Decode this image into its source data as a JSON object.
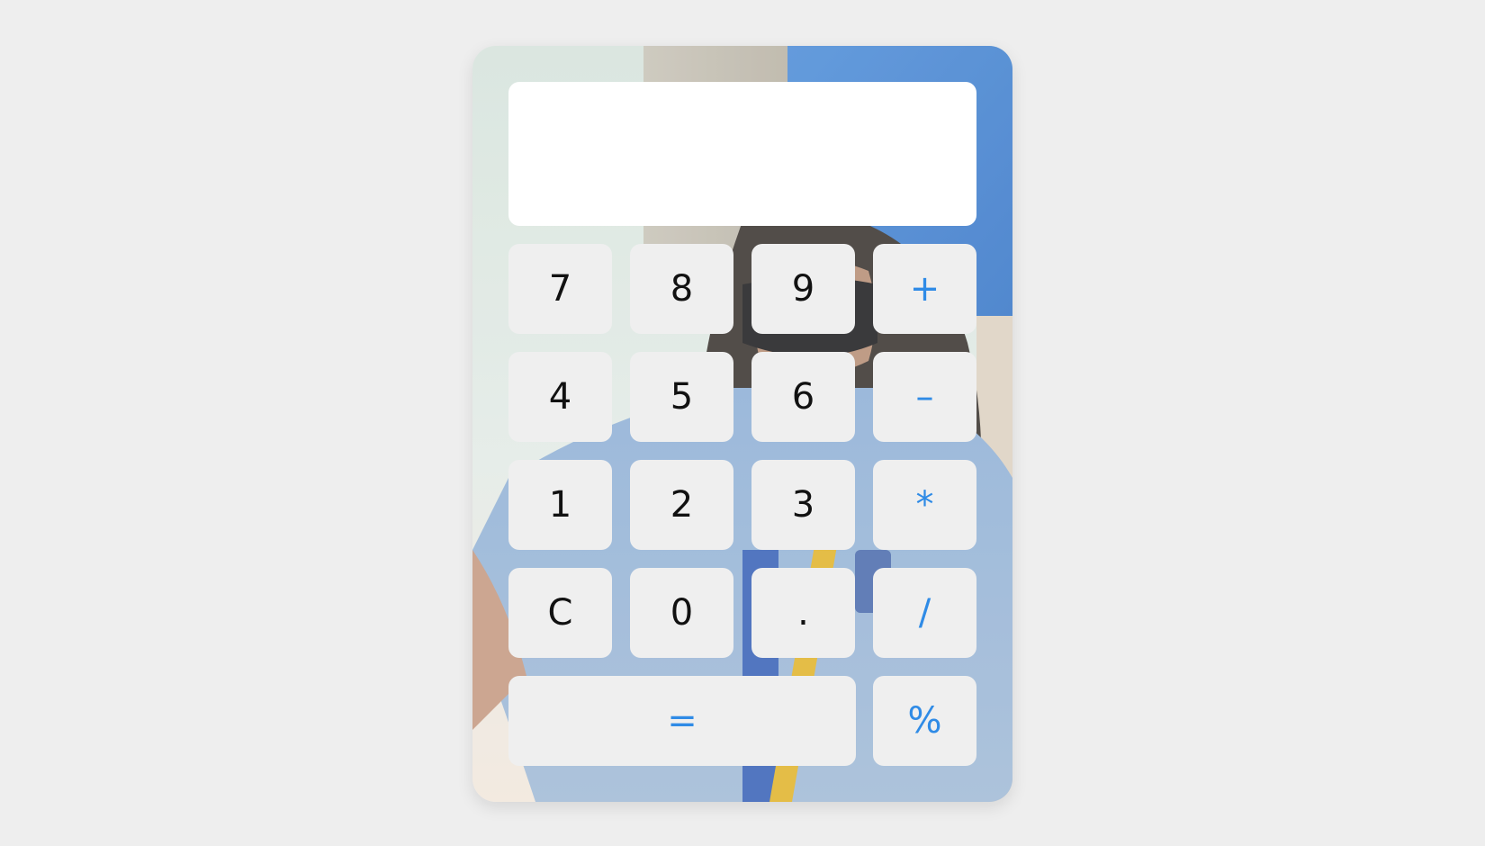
{
  "display": {
    "value": ""
  },
  "keys": {
    "seven": "7",
    "eight": "8",
    "nine": "9",
    "plus": "+",
    "four": "4",
    "five": "5",
    "six": "6",
    "minus": "–",
    "one": "1",
    "two": "2",
    "three": "3",
    "multiply": "*",
    "clear": "C",
    "zero": "0",
    "dot": ".",
    "divide": "/",
    "equals": "=",
    "percent": "%"
  },
  "colors": {
    "page_background": "#eeeeee",
    "key_background": "#efefef",
    "digit_text": "#111111",
    "operator_text": "#2f8be6",
    "display_background": "#ffffff"
  }
}
